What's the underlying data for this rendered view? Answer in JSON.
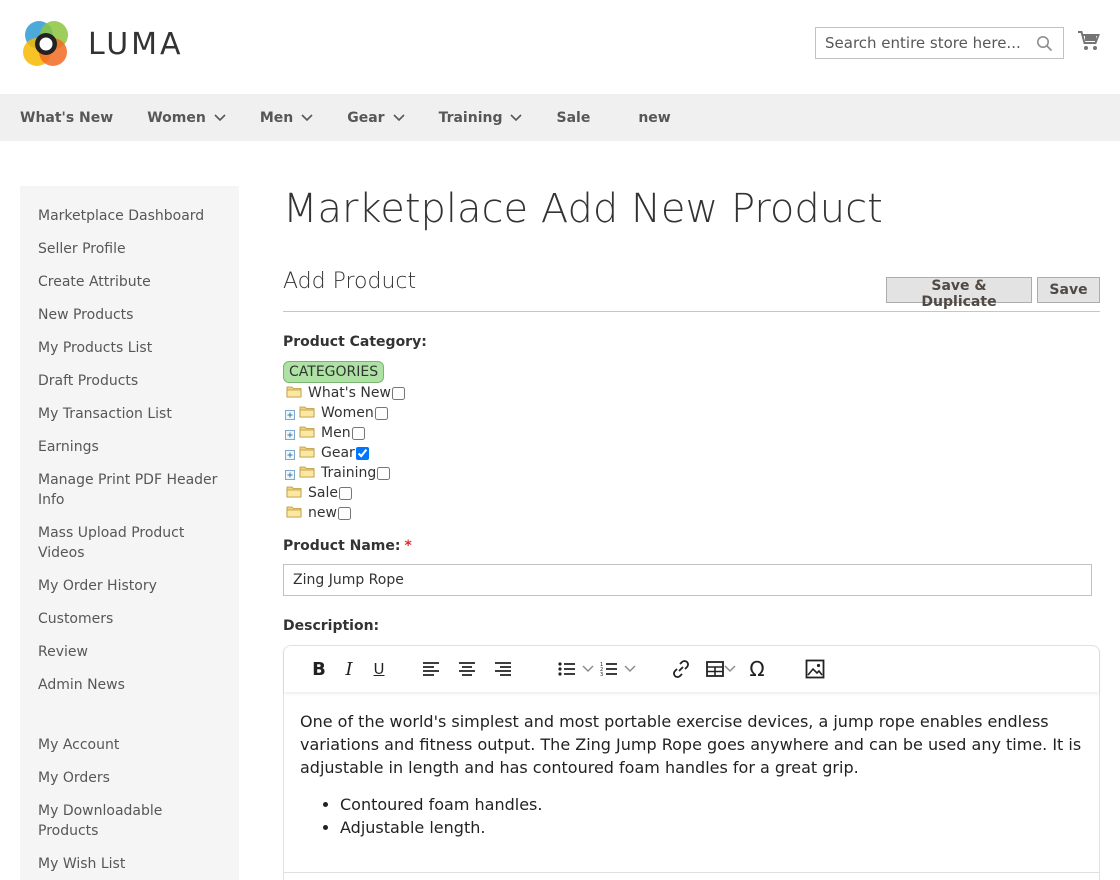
{
  "brand": {
    "name": "LUMA"
  },
  "search": {
    "placeholder": "Search entire store here..."
  },
  "nav": [
    {
      "label": "What's New",
      "has_menu": false
    },
    {
      "label": "Women",
      "has_menu": true
    },
    {
      "label": "Men",
      "has_menu": true
    },
    {
      "label": "Gear",
      "has_menu": true
    },
    {
      "label": "Training",
      "has_menu": true
    },
    {
      "label": "Sale",
      "has_menu": false
    },
    {
      "label": "new",
      "has_menu": false
    }
  ],
  "sidebar": {
    "marketplace": [
      "Marketplace Dashboard",
      "Seller Profile",
      "Create Attribute",
      "New Products",
      "My Products List",
      "Draft Products",
      "My Transaction List",
      "Earnings",
      "Manage Print PDF Header Info",
      "Mass Upload Product Videos",
      "My Order History",
      "Customers",
      "Review",
      "Admin News"
    ],
    "account": [
      "My Account",
      "My Orders",
      "My Downloadable Products",
      "My Wish List"
    ]
  },
  "page": {
    "title": "Marketplace Add New Product",
    "section_title": "Add Product",
    "save_duplicate_label": "Save & Duplicate",
    "save_label": "Save"
  },
  "category": {
    "label": "Product Category:",
    "root": "CATEGORIES",
    "items": [
      {
        "label": "What's New",
        "expandable": false,
        "checked": false
      },
      {
        "label": "Women",
        "expandable": true,
        "checked": false
      },
      {
        "label": "Men",
        "expandable": true,
        "checked": false
      },
      {
        "label": "Gear",
        "expandable": true,
        "checked": true
      },
      {
        "label": "Training",
        "expandable": true,
        "checked": false
      },
      {
        "label": "Sale",
        "expandable": false,
        "checked": false
      },
      {
        "label": "new",
        "expandable": false,
        "checked": false
      }
    ]
  },
  "product_name": {
    "label": "Product Name:",
    "required_mark": "*",
    "value": "Zing Jump Rope"
  },
  "description": {
    "label": "Description:",
    "paragraph": "One of the world's simplest and most portable exercise devices, a jump rope enables endless variations and fitness output. The Zing Jump Rope goes anywhere and can be used any time. It is adjustable in length and has contoured foam handles for a great grip.",
    "bullets": [
      "Contoured foam handles.",
      "Adjustable length."
    ]
  },
  "colors": {
    "nav_bg": "#f0f0f0",
    "sidebar_bg": "#f5f5f5",
    "category_root_bg": "#aee2a5",
    "required": "#e02b27",
    "button_bg": "#e3e3e3"
  },
  "icons": [
    "luma-logo-icon",
    "search-icon",
    "cart-icon",
    "chevron-down-icon",
    "folder-icon",
    "expand-plus-icon",
    "bold-icon",
    "italic-icon",
    "underline-icon",
    "align-left-icon",
    "align-center-icon",
    "align-right-icon",
    "bullet-list-icon",
    "numbered-list-icon",
    "link-icon",
    "table-icon",
    "special-char-icon",
    "image-icon"
  ]
}
